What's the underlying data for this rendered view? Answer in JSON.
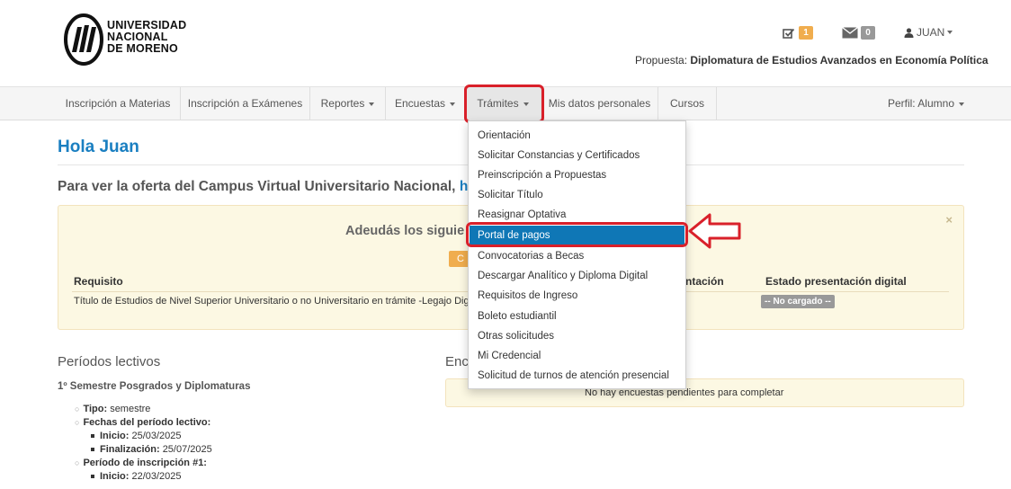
{
  "header": {
    "logo_lines": [
      "UNIVERSIDAD",
      "NACIONAL",
      "DE MORENO"
    ],
    "tasks_count": "1",
    "messages_count": "0",
    "user": "JUAN",
    "propuesta_label": "Propuesta:",
    "propuesta_value": "Diplomatura de Estudios Avanzados en Economía Política"
  },
  "nav": {
    "items": [
      {
        "label": "Inscripción a Materias"
      },
      {
        "label": "Inscripción a Exámenes"
      },
      {
        "label": "Reportes"
      },
      {
        "label": "Encuestas"
      },
      {
        "label": "Trámites"
      },
      {
        "label": "Mis datos personales"
      },
      {
        "label": "Cursos"
      }
    ],
    "profile": "Perfil: Alumno"
  },
  "dropdown": {
    "items": [
      {
        "label": "Orientación"
      },
      {
        "label": "Solicitar Constancias y Certificados"
      },
      {
        "label": "Preinscripción a Propuestas"
      },
      {
        "label": "Solicitar Título"
      },
      {
        "label": "Reasignar Optativa"
      },
      {
        "label": "Portal de pagos"
      },
      {
        "label": "Convocatorias a Becas"
      },
      {
        "label": "Descargar Analítico y Diploma Digital"
      },
      {
        "label": "Requisitos de Ingreso"
      },
      {
        "label": "Boleto estudiantil"
      },
      {
        "label": "Otras solicitudes"
      },
      {
        "label": "Mi Credencial"
      },
      {
        "label": "Solicitud de turnos de atención presencial"
      }
    ],
    "highlighted": "Portal de pagos"
  },
  "main": {
    "greeting": "Hola Juan",
    "oferta_text": "Para ver la oferta del Campus Virtual Universitario Nacional,",
    "oferta_link": "h",
    "alert": {
      "title": "Adeudás los siguie",
      "button_label": "C",
      "close": "×",
      "col_requisito": "Requisito",
      "col_presentacion": "ntación",
      "col_estado": "Estado presentación digital",
      "row_requisito": "Título de Estudios de Nivel Superior Universitario o no Universitario en trámite -Legajo Dig",
      "row_estado": "-- No cargado --"
    },
    "periodos_title": "Períodos lectivos",
    "encuestas_title": "Enc",
    "encuestas_message": "No hay encuestas pendientes para completar",
    "semestre_title": "1º Semestre Posgrados y Diplomaturas",
    "tipo_label": "Tipo:",
    "tipo_value": "semestre",
    "fechas_label": "Fechas del período lectivo:",
    "inicio_label": "Inicio:",
    "inicio_value": "25/03/2025",
    "fin_label": "Finalización:",
    "fin_value": "25/07/2025",
    "insc_label": "Período de inscripción #1:",
    "insc_inicio_label": "Inicio:",
    "insc_inicio_value": "22/03/2025"
  },
  "colors": {
    "brand_blue": "#1a7fc1",
    "highlight_red": "#d9202a",
    "active_item": "#0f77b6",
    "warning_bg": "#fcf8e3",
    "badge_orange": "#f0ad4e"
  }
}
